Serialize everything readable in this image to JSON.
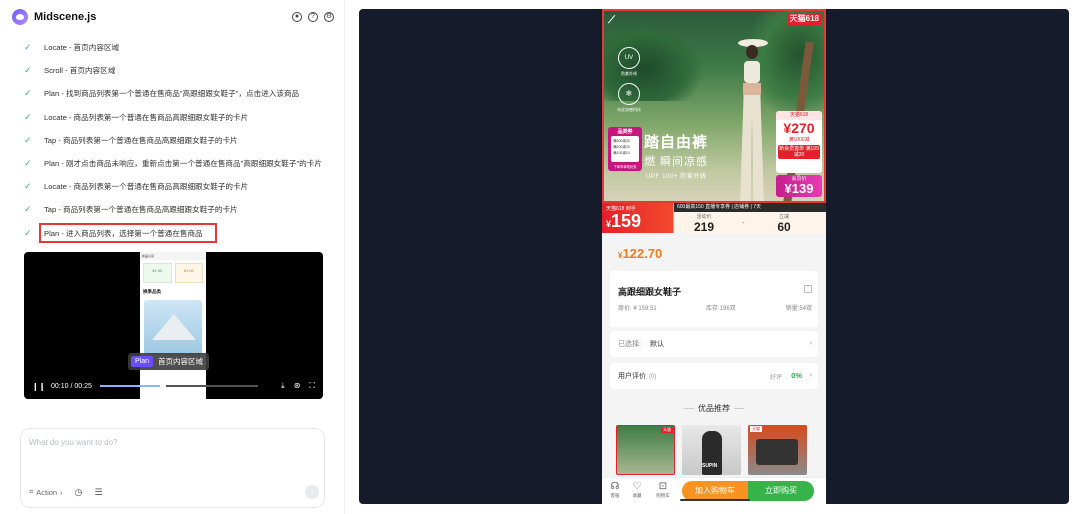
{
  "app": {
    "title": "Midscene.js"
  },
  "tasks": [
    {
      "text": "Locate - 首页内容区域"
    },
    {
      "text": "Scroll - 首页内容区域"
    },
    {
      "text": "Plan - 找到商品列表第一个普通在售商品\"高跟细跟女鞋子\"，点击进入该商品"
    },
    {
      "text": "Locate - 商品列表第一个普通在售商品高跟细跟女鞋子的卡片"
    },
    {
      "text": "Tap - 商品列表第一个普通在售商品高跟细跟女鞋子的卡片"
    },
    {
      "text": "Plan - 刚才点击商品未响应，重新点击第一个普通在售商品\"高跟细跟女鞋子\"的卡片"
    },
    {
      "text": "Locate - 商品列表第一个普通在售商品高跟细跟女鞋子的卡片"
    },
    {
      "text": "Tap - 商品列表第一个普通在售商品高跟细跟女鞋子的卡片"
    },
    {
      "text": "Plan - 进入商品列表，选择第一个普通在售商品"
    }
  ],
  "player": {
    "caption_tag": "Plan",
    "caption_text": "首页内容区域",
    "time": "00:10 / 00:25",
    "progress": 0.4,
    "preview": {
      "header": "新品认货",
      "card1": "¥1.00",
      "card2": "¥1.00",
      "section": "换季品类"
    }
  },
  "prompt": {
    "placeholder": "What do you want to do?",
    "action_label": "Action"
  },
  "product": {
    "banner": {
      "tmall": "天猫618",
      "uv_label": "UV",
      "uv_text": "防紫外线",
      "ice_label": "❄",
      "ice_text": "冰丝凉感科技",
      "coupon_tag": "品类券",
      "coupon_lines": [
        "满300减30",
        "满200减20",
        "满100减10"
      ],
      "coupon_foot": "下单享单笔优惠",
      "slogan": "踏自由裤",
      "slogan2": "燃 瞬间凉感",
      "slogan3": "UPF 100+ 防紫外线",
      "price_card_head": "天猫618",
      "price_card_price": "¥270",
      "price_card_sub": "满1000减",
      "price_card_red": "新会员首单 满199减20",
      "promo_card_head": "会员价",
      "promo_card_price": "¥139"
    },
    "pricebar": {
      "label": "天猫618 到手",
      "price": "159",
      "promo": "600最高150 直播专享券 | 店铺券 | 7天",
      "stat1_label": "活动价",
      "stat1_value": "219",
      "stat2_label": "立减",
      "stat2_value": "60"
    },
    "sale_price": "122.70",
    "title": "高跟细跟女鞋子",
    "original_price": "原价: ¥ 159.51",
    "stock": "库存:196双",
    "sold": "销量:54双",
    "selected_label": "已选择:",
    "selected_value": "默认",
    "review_label": "用户评价",
    "review_count": "(0)",
    "good_label": "好评",
    "good_pct": "0%",
    "rec_title": "优品推荐",
    "rec1_tag": "天猫",
    "rec2_text": "SUPIN",
    "rec3_tag": "天猫",
    "tabbar": [
      {
        "icon": "☊",
        "label": "客服"
      },
      {
        "icon": "♡",
        "label": "收藏"
      },
      {
        "icon": "⊡",
        "label": "购物车"
      }
    ],
    "add_cart": "加入购物车",
    "buy_now": "立即购买"
  },
  "colors": {
    "accent": "#6a4cff",
    "highlight": "#e53935",
    "price_orange": "#f47a1f",
    "cart_orange": "#f7931e",
    "buy_green": "#36b44a"
  }
}
